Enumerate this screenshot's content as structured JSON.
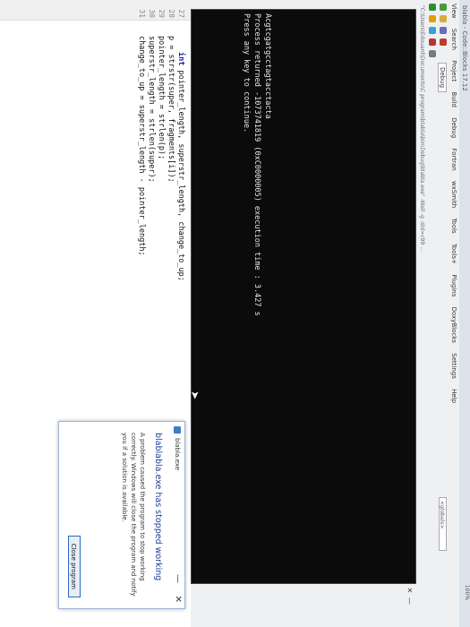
{
  "app": {
    "title": "blabla - Code::Blocks 17.12"
  },
  "menu": [
    "View",
    "Search",
    "Project",
    "Build",
    "Debug",
    "Fortran",
    "wxSmith",
    "Tools",
    "Tools+",
    "Plugins",
    "DoxyBlocks",
    "Settings",
    "Help"
  ],
  "toolbar": {
    "build_target": "Debug",
    "globals_select": "<globals>",
    "zoom": "100%"
  },
  "path": "\"C:\\Users\\Edouard\\Documents\\C program\\blabla\\bin\\Debug\\blabla.exe\" -Wall -g -std=c99 ...",
  "console": {
    "line1": "Acgtcgatgcctagtacctacta",
    "line2": "Process returned -1073741819 (0xC0000005)   execution time : 3.427 s",
    "line3": "Press any key to continue."
  },
  "editor": {
    "lines": [
      {
        "num": "27",
        "code_kw": "int",
        "code": " pointer_length, superstr_length, change_to_up;"
      },
      {
        "num": "28",
        "code_kw": "",
        "code": "p = strstr(super, fragments[i]);"
      },
      {
        "num": "29",
        "code_kw": "",
        "code": "pointer_length = strlen(p);"
      },
      {
        "num": "30",
        "code_kw": "",
        "code": "superstr_length = strlen(super);"
      },
      {
        "num": "31",
        "code_kw": "",
        "code": "change_to_up = superstr_length - pointer_length;"
      }
    ]
  },
  "dialog": {
    "title": "blabla.exe",
    "heading": "blablabla.exe has stopped working",
    "body": "A problem caused the program to stop working correctly. Windows will close the program and notify you if a solution is available.",
    "button": "Close program",
    "close_glyph": "✕",
    "min_glyph": "—"
  },
  "console_close_glyph": "✕",
  "console_min_glyph": "—",
  "colors": {
    "console_bg": "#0b0b0b",
    "dialog_heading": "#1f3f9a",
    "button_border": "#2c69c4"
  }
}
